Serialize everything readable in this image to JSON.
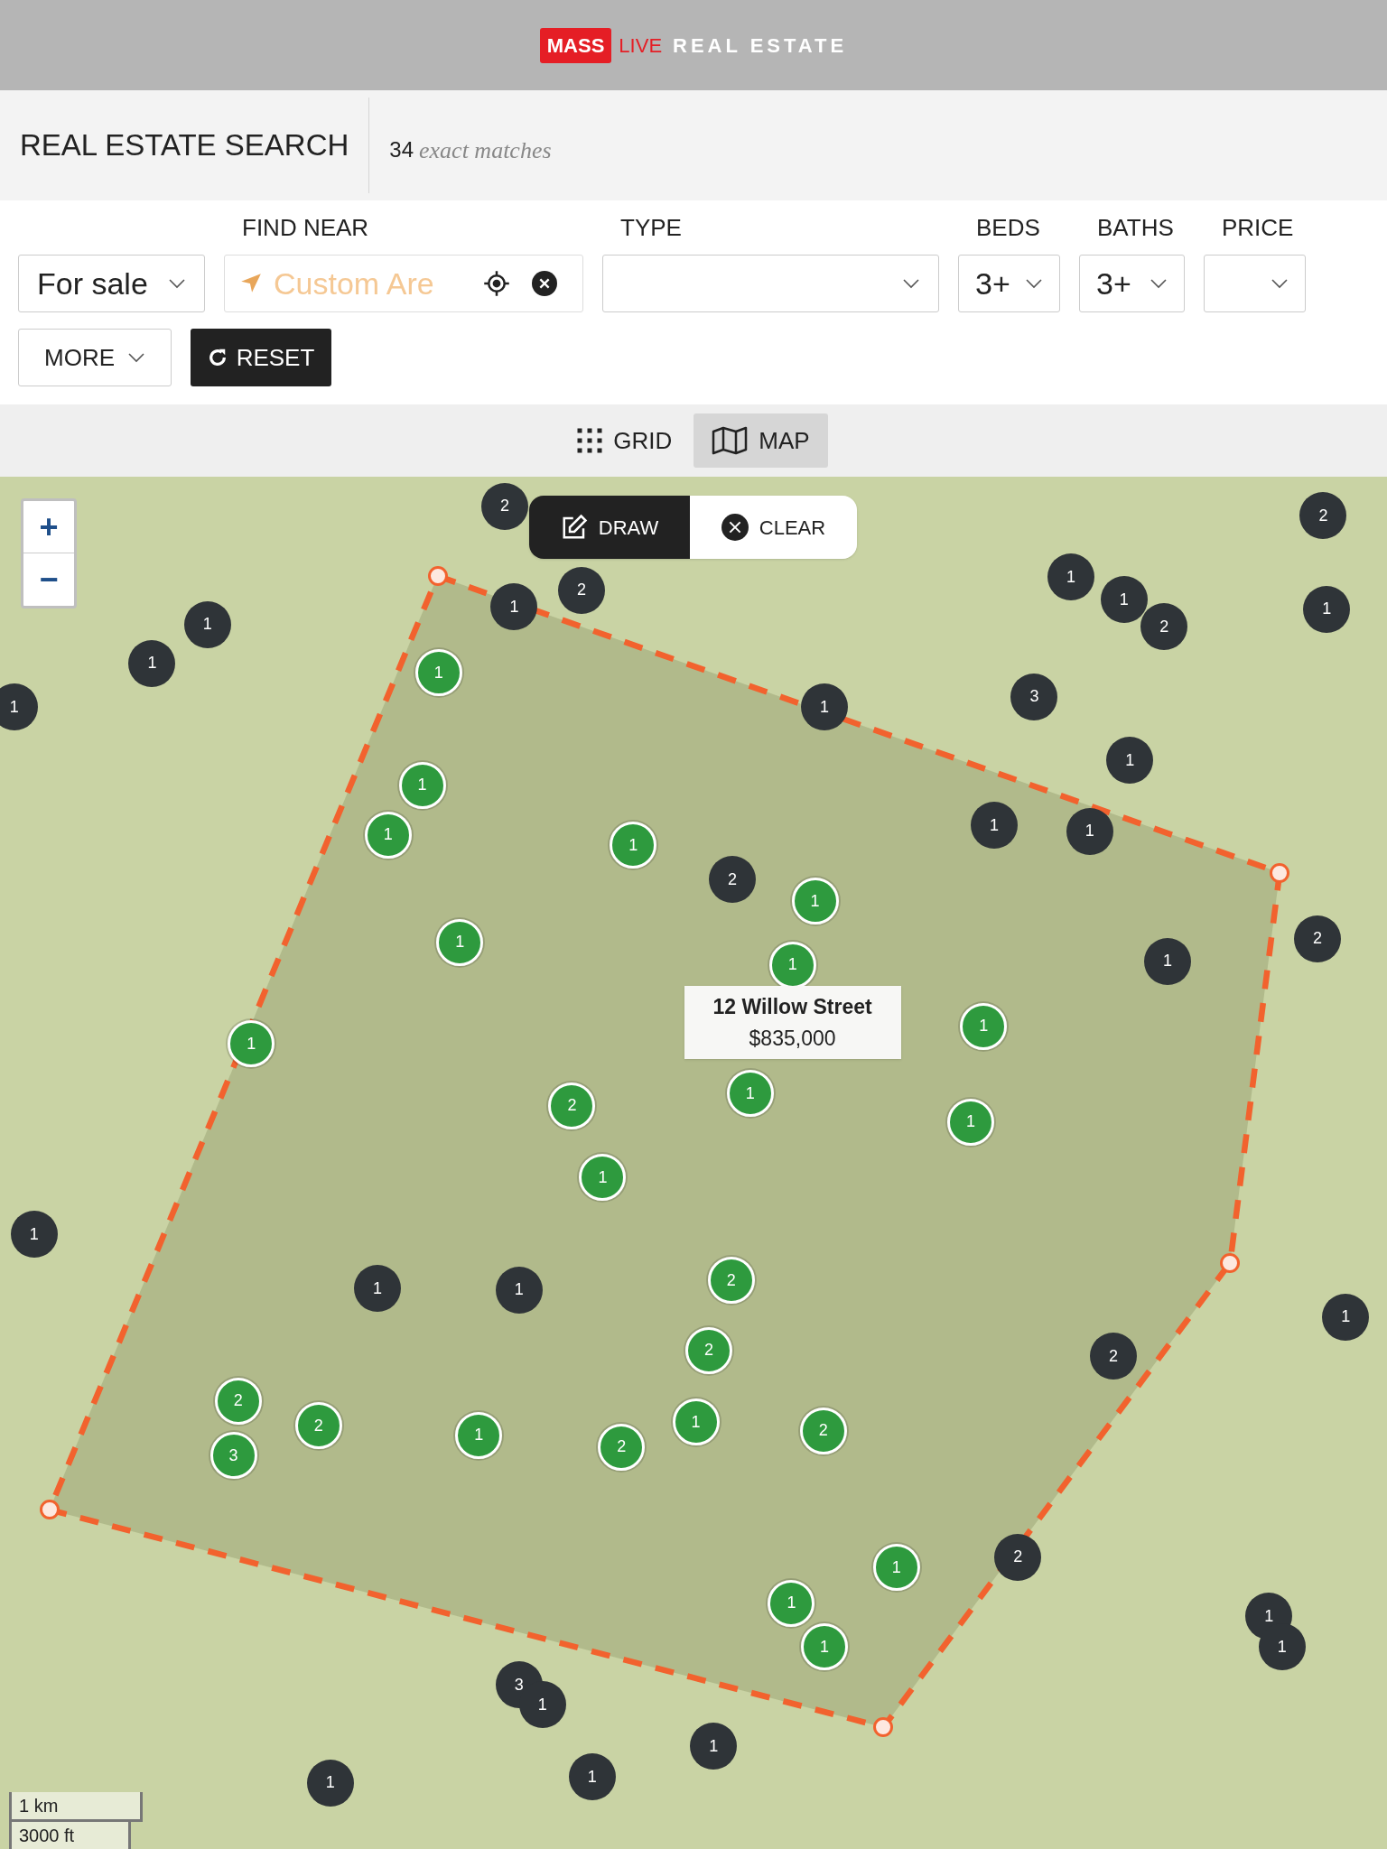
{
  "header": {
    "logo_box": "MASS",
    "logo_accent": "LIVE",
    "logo_text": "REAL ESTATE"
  },
  "search_bar": {
    "title": "REAL ESTATE SEARCH",
    "count": "34",
    "count_label": "exact matches"
  },
  "filters": {
    "listing_type": {
      "value": "For sale"
    },
    "find_near": {
      "label": "FIND NEAR",
      "placeholder": "Custom Are"
    },
    "type": {
      "label": "TYPE"
    },
    "beds": {
      "label": "BEDS",
      "value": "3+"
    },
    "baths": {
      "label": "BATHS",
      "value": "3+"
    },
    "price": {
      "label": "PRICE"
    },
    "more": "MORE",
    "reset": "RESET"
  },
  "view_tabs": [
    {
      "label": "GRID",
      "selected": false,
      "kind": "grid"
    },
    {
      "label": "MAP",
      "selected": true,
      "kind": "map"
    }
  ],
  "map": {
    "zoom_in": "+",
    "zoom_out": "−",
    "draw": "DRAW",
    "clear": "CLEAR",
    "popup": {
      "address": "12 Willow Street",
      "price": "$835,000"
    },
    "scale": [
      "1 km",
      "3000 ft"
    ],
    "markers": [
      {
        "label": "2",
        "kind": "other"
      },
      {
        "label": "2",
        "kind": "other"
      },
      {
        "label": "1",
        "kind": "other"
      },
      {
        "label": "1",
        "kind": "other"
      },
      {
        "label": "1",
        "kind": "other"
      },
      {
        "label": "1",
        "kind": "other"
      },
      {
        "label": "1",
        "kind": "other"
      },
      {
        "label": "1",
        "kind": "other"
      },
      {
        "label": "2",
        "kind": "other"
      },
      {
        "label": "2",
        "kind": "other"
      },
      {
        "label": "1",
        "kind": "other"
      },
      {
        "label": "3",
        "kind": "other"
      },
      {
        "label": "1",
        "kind": "other"
      },
      {
        "label": "1",
        "kind": "other"
      },
      {
        "label": "1",
        "kind": "other"
      },
      {
        "label": "1",
        "kind": "other"
      },
      {
        "label": "2",
        "kind": "other"
      },
      {
        "label": "2",
        "kind": "other"
      },
      {
        "label": "1",
        "kind": "other"
      },
      {
        "label": "1",
        "kind": "other"
      },
      {
        "label": "1",
        "kind": "other"
      },
      {
        "label": "1",
        "kind": "other"
      },
      {
        "label": "1",
        "kind": "other"
      },
      {
        "label": "2",
        "kind": "other"
      },
      {
        "label": "2",
        "kind": "other"
      },
      {
        "label": "1",
        "kind": "other"
      },
      {
        "label": "1",
        "kind": "other"
      },
      {
        "label": "3",
        "kind": "other"
      },
      {
        "label": "1",
        "kind": "other"
      },
      {
        "label": "1",
        "kind": "other"
      },
      {
        "label": "1",
        "kind": "other"
      },
      {
        "label": "1",
        "kind": "other"
      },
      {
        "label": "1",
        "kind": "match"
      },
      {
        "label": "1",
        "kind": "match"
      },
      {
        "label": "1",
        "kind": "match"
      },
      {
        "label": "1",
        "kind": "match"
      },
      {
        "label": "1",
        "kind": "match"
      },
      {
        "label": "1",
        "kind": "match"
      },
      {
        "label": "1",
        "kind": "match"
      },
      {
        "label": "1",
        "kind": "match"
      },
      {
        "label": "1",
        "kind": "match"
      },
      {
        "label": "2",
        "kind": "match"
      },
      {
        "label": "1",
        "kind": "match"
      },
      {
        "label": "1",
        "kind": "match"
      },
      {
        "label": "1",
        "kind": "match"
      },
      {
        "label": "2",
        "kind": "match"
      },
      {
        "label": "2",
        "kind": "match"
      },
      {
        "label": "2",
        "kind": "match"
      },
      {
        "label": "2",
        "kind": "match"
      },
      {
        "label": "3",
        "kind": "match"
      },
      {
        "label": "1",
        "kind": "match"
      },
      {
        "label": "2",
        "kind": "match"
      },
      {
        "label": "1",
        "kind": "match"
      },
      {
        "label": "2",
        "kind": "match"
      },
      {
        "label": "1",
        "kind": "match"
      },
      {
        "label": "1",
        "kind": "match"
      },
      {
        "label": "1",
        "kind": "match"
      }
    ]
  }
}
